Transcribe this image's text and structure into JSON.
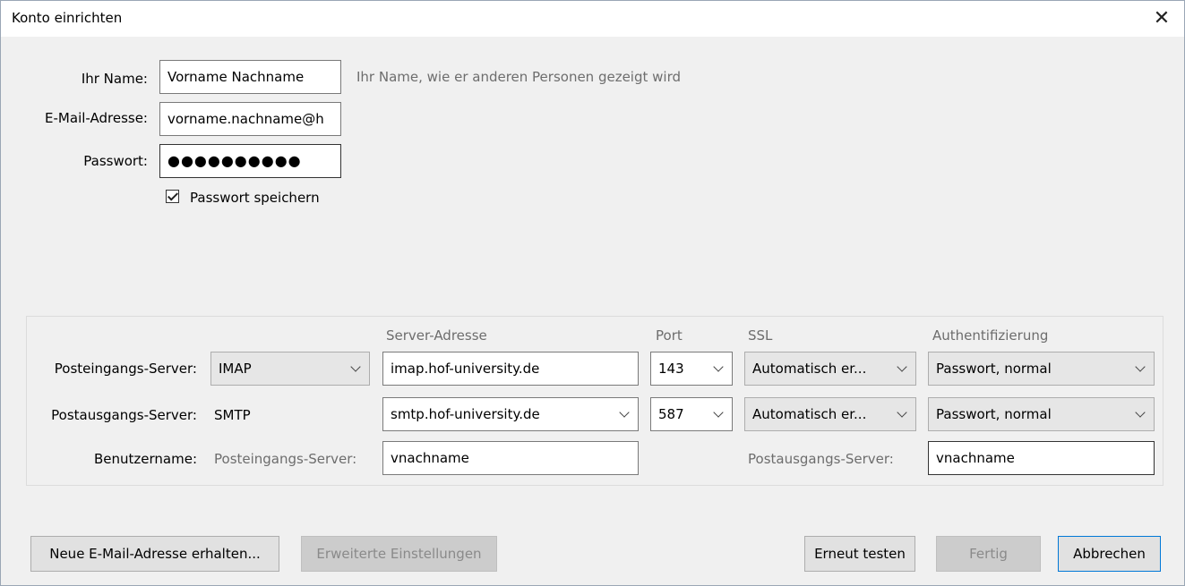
{
  "window": {
    "title": "Konto einrichten",
    "close_glyph": "✕"
  },
  "account": {
    "name_label": "Ihr Name:",
    "name_value": "Vorname Nachname",
    "name_hint": "Ihr Name, wie er anderen Personen gezeigt wird",
    "email_label": "E-Mail-Adresse:",
    "email_value": "vorname.nachname@h",
    "password_label": "Passwort:",
    "password_value": "●●●●●●●●●●",
    "remember_label": "Passwort speichern",
    "remember_checked": true
  },
  "servers": {
    "headers": {
      "address": "Server-Adresse",
      "port": "Port",
      "ssl": "SSL",
      "auth": "Authentifizierung"
    },
    "incoming": {
      "label": "Posteingangs-Server:",
      "protocol": "IMAP",
      "address": "imap.hof-university.de",
      "port": "143",
      "ssl": "Automatisch er...",
      "auth": "Passwort, normal"
    },
    "outgoing": {
      "label": "Postausgangs-Server:",
      "protocol": "SMTP",
      "address": "smtp.hof-university.de",
      "port": "587",
      "ssl": "Automatisch er...",
      "auth": "Passwort, normal"
    },
    "username": {
      "label": "Benutzername:",
      "incoming_label": "Posteingangs-Server:",
      "incoming_value": "vnachname",
      "outgoing_label": "Postausgangs-Server:",
      "outgoing_value": "vnachname"
    }
  },
  "buttons": {
    "new_address": "Neue E-Mail-Adresse erhalten...",
    "advanced": "Erweiterte Einstellungen",
    "retest": "Erneut testen",
    "done": "Fertig",
    "cancel": "Abbrechen"
  }
}
